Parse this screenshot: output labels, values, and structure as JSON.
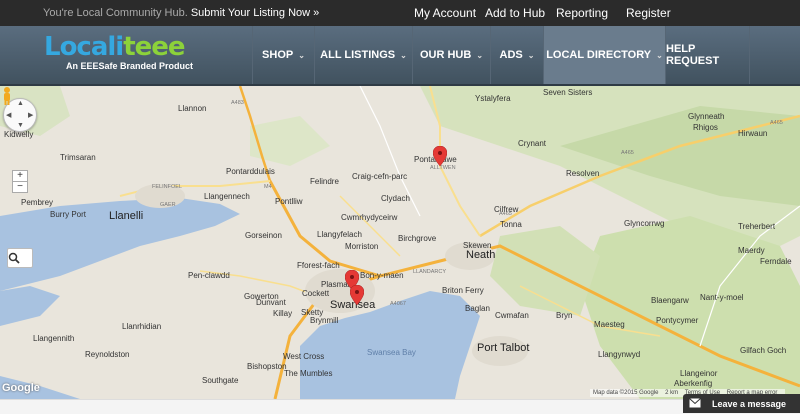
{
  "topbar": {
    "tagline": "You're Local Community Hub.",
    "tagline_link": "Submit Your Listing Now »",
    "links": [
      "My Account",
      "Add to Hub",
      "Reporting",
      "Register"
    ]
  },
  "logo": {
    "part1": "Locali",
    "part2": "teee",
    "subtitle": "An EEESafe Branded Product"
  },
  "nav": {
    "items": [
      {
        "label": "SHOP"
      },
      {
        "label": "ALL LISTINGS"
      },
      {
        "label": "OUR HUB"
      },
      {
        "label": "ADS"
      },
      {
        "label": "LOCAL DIRECTORY"
      },
      {
        "label": "HELP REQUEST"
      }
    ],
    "chevron": "⌄"
  },
  "map": {
    "zoom_in": "+",
    "zoom_out": "−",
    "google": "Google",
    "map_data": "Map data ©2015 Google",
    "scale": "2 km",
    "terms": "Terms of Use",
    "report": "Report a map error",
    "places": {
      "ystalyfera": "Ystalyfera",
      "seven_sisters": "Seven Sisters",
      "glynneath": "Glynneath",
      "rhigos": "Rhigos",
      "hirwaun": "Hirwaun",
      "kidwelly": "Kidwelly",
      "llannon": "Llannon",
      "pontardawe": "Pontardawe",
      "alltwen": "ALLTWEN",
      "crynant": "Crynant",
      "pontarddulais": "Pontarddulais",
      "craig_cefn_parc": "Craig-cefn-parc",
      "trimsaran": "Trimsaran",
      "felinfoel": "FELINFOEL",
      "felindre": "Felindre",
      "clydach": "Clydach",
      "resolven": "Resolven",
      "pembrey": "Pembrey",
      "llangennech": "Llangennech",
      "burry_port": "Burry Port",
      "llanelli": "Llanelli",
      "gaer": "GAER",
      "pontlliw": "Pontlliw",
      "cwmrhydyceirw": "Cwmrhydyceirw",
      "llangyfelach": "Llangyfelach",
      "cilfrew": "Cilfrew",
      "glyncorrwg": "Glyncorrwg",
      "treherbert": "Treherbert",
      "gorseinon": "Gorseinon",
      "birchgrove": "Birchgrove",
      "skewen": "Skewen",
      "tonna": "Tonna",
      "morriston": "Morriston",
      "neath": "Neath",
      "maerdy": "Maerdy",
      "ferndale": "Ferndale",
      "penclawdd": "Pen-clawdd",
      "gowerton": "Gowerton",
      "fforest_fach": "Fforest-fach",
      "bon_y_maen": "Bon-y-maen",
      "plasmarl": "Plasmarl",
      "llandarcy": "LLANDARCY",
      "cockett": "Cockett",
      "dunvant": "Dunvant",
      "baglan": "Baglan",
      "swansea": "Swansea",
      "briton_ferry": "Briton Ferry",
      "killay": "Killay",
      "sketty": "Sketty",
      "brynmill": "Brynmill",
      "llanrhidian": "Llanrhidian",
      "cwmafan": "Cwmafan",
      "bryn": "Bryn",
      "maesteg": "Maesteg",
      "blaengarw": "Blaengarw",
      "nant_y_moel": "Nant-y-moel",
      "pontycymer": "Pontycymer",
      "llangennith": "Llangennith",
      "reynoldston": "Reynoldston",
      "west_cross": "West Cross",
      "swansea_bay": "Swansea Bay",
      "port_talbot": "Port Talbot",
      "llangynwyd": "Llangynwyd",
      "gilfach_goch": "Gilfach Goch",
      "bishopston": "Bishopston",
      "the_mumbles": "The Mumbles",
      "southgate": "Southgate",
      "aberkenfig": "Aberkenfig",
      "llangeinor": "Llangeinor",
      "a465_1": "A465",
      "a465_2": "A465",
      "a465_3": "A465",
      "m4": "M4",
      "a483": "A483",
      "a4067": "A4067"
    }
  },
  "chat": {
    "label": "Leave a message"
  },
  "colors": {
    "topbar": "#2b2b2b",
    "nav_bg": "#4d5f70",
    "logo_blue": "#35a8e0",
    "logo_green": "#8cd23a",
    "water": "#a8c2e0",
    "land": "#e9e5dc",
    "forest": "#c9dbab",
    "motorway": "#f4b23c",
    "marker": "#e53935"
  },
  "icons": {
    "pan": "pan-control-icon",
    "pegman": "pegman-icon",
    "search": "magnifier-icon",
    "marker": "map-marker-icon",
    "mail": "envelope-icon"
  }
}
